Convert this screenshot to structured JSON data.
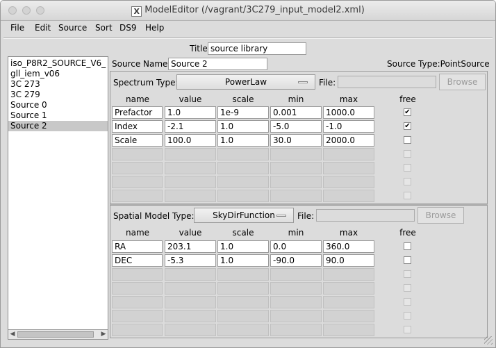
{
  "window": {
    "title": "ModelEditor (/vagrant/3C279_input_model2.xml)",
    "title_icon": "X"
  },
  "menu": [
    "File",
    "Edit",
    "Source",
    "Sort",
    "DS9",
    "Help"
  ],
  "library": {
    "title_label": "Title",
    "title_value": "source library"
  },
  "sources": {
    "items": [
      "iso_P8R2_SOURCE_V6_",
      "gll_iem_v06",
      "3C 273",
      "3C 279",
      "Source 0",
      "Source 1",
      "Source 2"
    ],
    "selected_index": 6
  },
  "source": {
    "name_label": "Source Name:",
    "name_value": "Source 2",
    "type_label": "Source Type:",
    "type_value": "PointSource"
  },
  "spectrum": {
    "type_label": "Spectrum Type:",
    "type_value": "PowerLaw",
    "file_label": "File:",
    "file_value": "",
    "browse_label": "Browse",
    "headers": [
      "name",
      "value",
      "scale",
      "min",
      "max",
      "free"
    ],
    "rows": [
      {
        "name": "Prefactor",
        "value": "1.0",
        "scale": "1e-9",
        "min": "0.001",
        "max": "1000.0",
        "free": true
      },
      {
        "name": "Index",
        "value": "-2.1",
        "scale": "1.0",
        "min": "-5.0",
        "max": "-1.0",
        "free": true
      },
      {
        "name": "Scale",
        "value": "100.0",
        "scale": "1.0",
        "min": "30.0",
        "max": "2000.0",
        "free": false
      }
    ],
    "empty_rows": 4
  },
  "spatial": {
    "type_label": "Spatial Model Type:",
    "type_value": "SkyDirFunction",
    "file_label": "File:",
    "file_value": "",
    "browse_label": "Browse",
    "headers": [
      "name",
      "value",
      "scale",
      "min",
      "max",
      "free"
    ],
    "rows": [
      {
        "name": "RA",
        "value": "203.1",
        "scale": "1.0",
        "min": "0.0",
        "max": "360.0",
        "free": false
      },
      {
        "name": "DEC",
        "value": "-5.3",
        "scale": "1.0",
        "min": "-90.0",
        "max": "90.0",
        "free": false
      }
    ],
    "empty_rows": 5
  }
}
